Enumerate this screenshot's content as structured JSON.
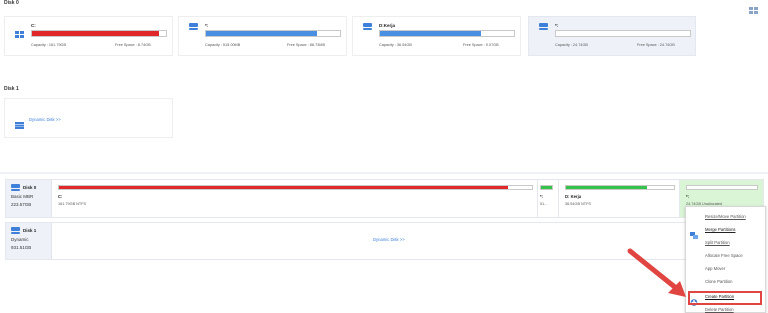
{
  "disk0_section": {
    "title": "Disk 0",
    "cards": [
      {
        "label": "C:",
        "capacity": "Capacity : 161.79GB",
        "free": "Free Space : 8.74GB",
        "fill_fraction": 0.95,
        "fill_color": "#e0282a",
        "icon": "windows-drive-icon"
      },
      {
        "label": "*:",
        "capacity": "Capacity : 515.00MB",
        "free": "Free Space : 88.73MB",
        "fill_fraction": 0.83,
        "fill_color": "#4a90e2",
        "icon": "drive-icon"
      },
      {
        "label": "D:Kerja",
        "capacity": "Capacity : 36.54GB",
        "free": "Free Space : 9.07GB",
        "fill_fraction": 0.75,
        "fill_color": "#4a90e2",
        "icon": "drive-icon"
      },
      {
        "label": "*:",
        "capacity": "Capacity : 24.74GB",
        "free": "Free Space : 24.74GB",
        "fill_fraction": 0.0,
        "fill_color": "#4a90e2",
        "icon": "drive-icon"
      }
    ]
  },
  "disk1_section": {
    "title": "Disk 1",
    "dynamic_link": "Dynamic Disk >>"
  },
  "disk_map": {
    "disk0": {
      "name": "Disk 0",
      "type": "Basic MBR",
      "size": "223.57GB",
      "partitions": [
        {
          "label": "C:",
          "detail": "161.79GB NTFS",
          "fill_fraction": 0.95,
          "fill_color": "#e0282a"
        },
        {
          "label": "*:",
          "detail": "51...",
          "fill_fraction": 1.0,
          "fill_color": "#35c24a"
        },
        {
          "label": "D: Kerja",
          "detail": "36.54GB NTFS",
          "fill_fraction": 0.75,
          "fill_color": "#35c24a"
        },
        {
          "label": "*:",
          "detail": "24.74GB Unallocated",
          "fill_fraction": 0.0,
          "fill_color": "#35c24a"
        }
      ]
    },
    "disk1": {
      "name": "Disk 1",
      "type": "Dynamic",
      "size": "931.51GB",
      "link": "Dynamic Disk >>"
    }
  },
  "context_menu": {
    "items": [
      {
        "label": "Resize/Move Partition",
        "state": "disabled"
      },
      {
        "label": "Merge Partitions",
        "state": "enabled",
        "icon": "merge-icon"
      },
      {
        "label": "Split Partition",
        "state": "disabled"
      },
      {
        "label": "Allocate Free Space",
        "state": "disabled"
      },
      {
        "label": "App Mover",
        "state": "disabled"
      },
      {
        "label": "Clone Partition",
        "state": "disabled"
      },
      {
        "label": "Create Partition",
        "state": "highlighted",
        "icon": "create-partition-icon"
      },
      {
        "label": "Delete Partition",
        "state": "disabled"
      }
    ]
  },
  "colors": {
    "accent_blue": "#3d7fd9",
    "used_red": "#e0282a",
    "used_green": "#35c24a",
    "unallocated_bg": "#d9f5d6",
    "highlight_red": "#e04541"
  }
}
